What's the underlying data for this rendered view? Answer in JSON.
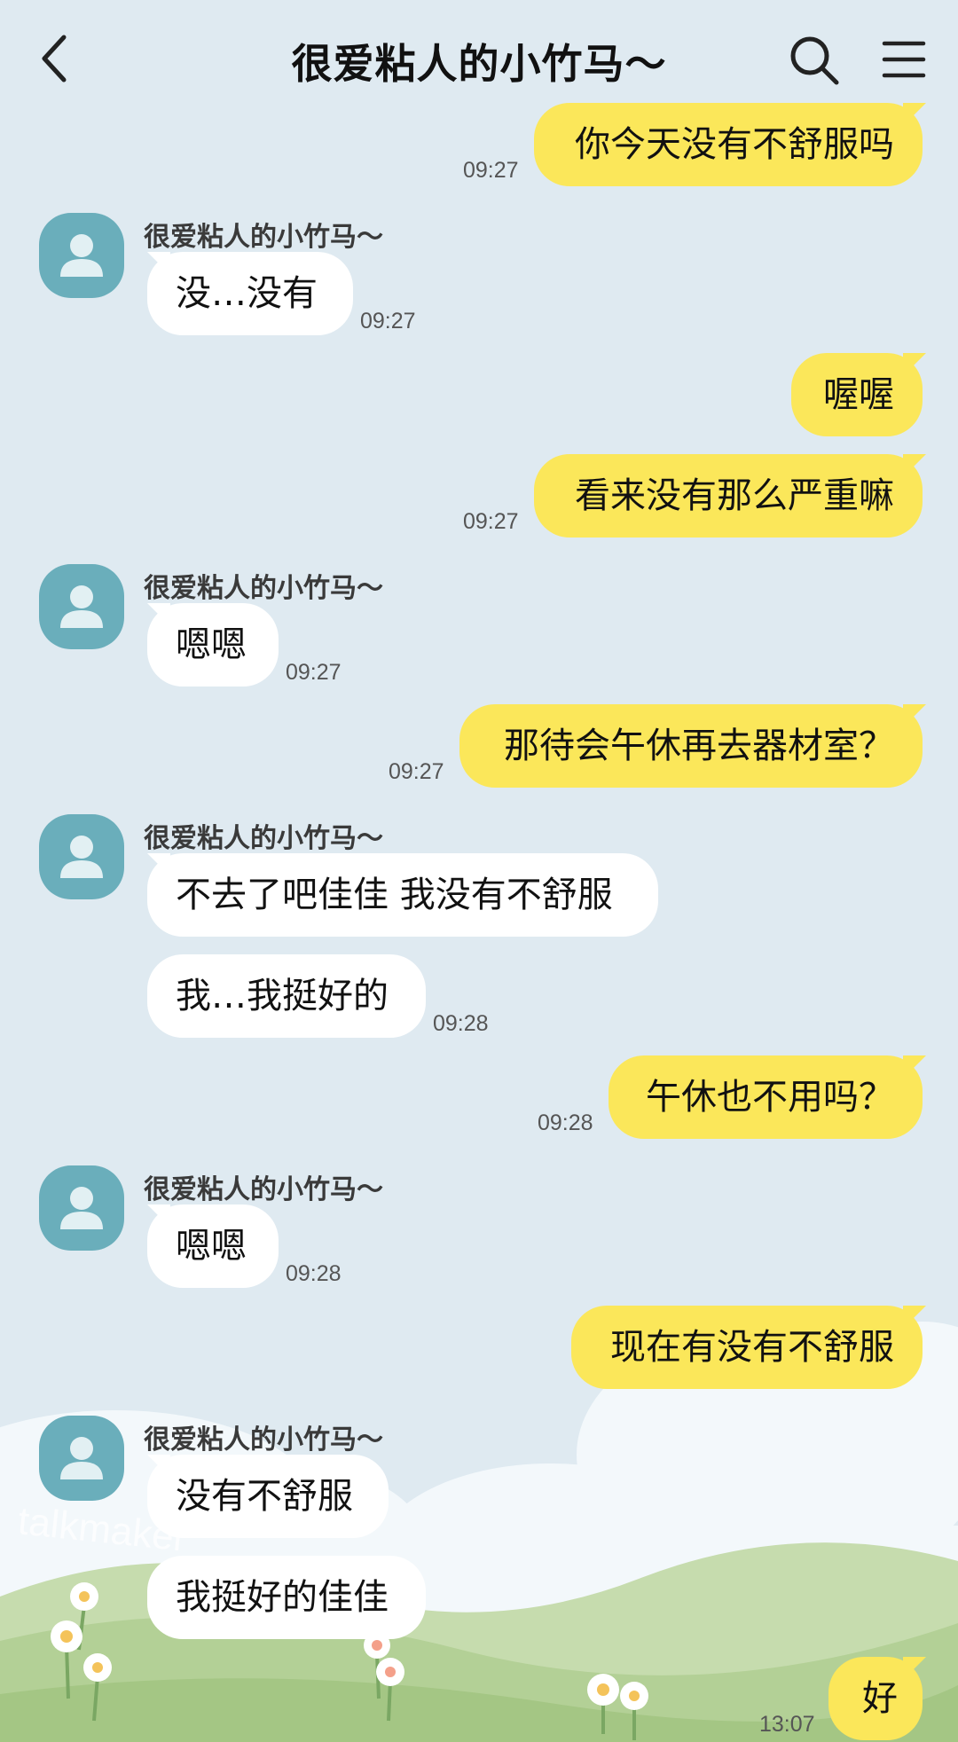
{
  "header": {
    "title": "很爱粘人的小竹马～",
    "back_icon": "chevron-left-icon",
    "search_icon": "search-icon",
    "menu_icon": "hamburger-menu-icon"
  },
  "contact_name": "很爱粘人的小竹马～",
  "messages": [
    {
      "side": "me",
      "text": "你今天没有不舒服吗",
      "time": "09:27"
    },
    {
      "side": "them",
      "text": "没…没有",
      "time": "09:27"
    },
    {
      "side": "me",
      "text": "喔喔",
      "time": ""
    },
    {
      "side": "me",
      "text": "看来没有那么严重嘛",
      "time": "09:27"
    },
    {
      "side": "them",
      "text": "嗯嗯",
      "time": "09:27"
    },
    {
      "side": "me",
      "text": "那待会午休再去器材室？",
      "time": "09:27"
    },
    {
      "side": "them",
      "text": "不去了吧佳佳 我没有不舒服",
      "time": ""
    },
    {
      "side": "them",
      "text": "我…我挺好的",
      "time": "09:28"
    },
    {
      "side": "me",
      "text": "午休也不用吗？",
      "time": "09:28"
    },
    {
      "side": "them",
      "text": "嗯嗯",
      "time": "09:28"
    },
    {
      "side": "me",
      "text": "现在有没有不舒服",
      "time": ""
    },
    {
      "side": "them",
      "text": "没有不舒服",
      "time": ""
    },
    {
      "side": "them",
      "text": "我挺好的佳佳",
      "time": ""
    },
    {
      "side": "me",
      "text": "好",
      "time": "13:07"
    }
  ],
  "watermark": "talkmaker",
  "colors": {
    "background": "#dfeaf1",
    "my_bubble": "#fbe75a",
    "their_bubble": "#ffffff",
    "avatar": "#6aaebb"
  }
}
